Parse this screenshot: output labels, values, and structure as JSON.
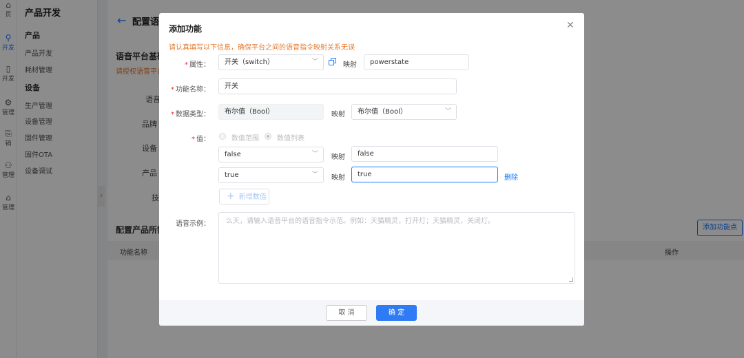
{
  "iconbar": [
    {
      "glyph": "⌂",
      "label": "页",
      "icon": "home-icon"
    },
    {
      "glyph": "⚲",
      "label": "开发",
      "icon": "dev-icon",
      "active": true
    },
    {
      "glyph": "▯",
      "label": "开发",
      "icon": "device-dev-icon"
    },
    {
      "glyph": "⚙",
      "label": "管理",
      "icon": "manage-icon"
    },
    {
      "glyph": "⎘",
      "label": "销",
      "icon": "sales-icon"
    },
    {
      "glyph": "⚇",
      "label": "管理",
      "icon": "user-manage-icon"
    },
    {
      "glyph": "⌂",
      "label": "管理",
      "icon": "misc-manage-icon"
    }
  ],
  "sidebar": {
    "title": "产品开发",
    "group1": "产品",
    "group1_items": [
      "产品开发",
      "耗材管理"
    ],
    "group2": "设备",
    "group2_items": [
      "生产管理",
      "设备管理",
      "固件管理",
      "固件OTA",
      "设备调试"
    ]
  },
  "page": {
    "title": "配置语音",
    "section1": "语音平台基础",
    "section1_note": "请授权语音平台",
    "field_labels": [
      "语音",
      "品牌",
      "设备",
      "产品",
      "技"
    ],
    "section2": "配置产品所需",
    "add_feature_button": "添加功能点",
    "table_headers": [
      "功能名称",
      "操作"
    ]
  },
  "modal": {
    "title": "添加功能",
    "notice": "请认真填写以下信息，确保平台之间的语音指令映射关系无误",
    "attribute_label": "属性：",
    "attribute_value": "开关（switch）",
    "map_label": "映射",
    "attribute_map_value": "powerstate",
    "name_label": "功能名称：",
    "name_value": "开关",
    "datatype_label": "数据类型：",
    "datatype_value": "布尔值（Bool）",
    "datatype_map_value": "布尔值（Bool）",
    "value_label": "值：",
    "radio_range": "数值范围",
    "radio_list": "数值列表",
    "values": [
      {
        "value": "false",
        "map": "false"
      },
      {
        "value": "true",
        "map": "true"
      }
    ],
    "delete_label": "删除",
    "add_value_button": "新增数值",
    "example_label": "语音示例：",
    "example_placeholder": "么天，请输入语音平台的语音指令示范。例如：天猫精灵，打开灯；天猫精灵，关闭灯。",
    "cancel_button": "取 消",
    "ok_button": "确 定"
  }
}
